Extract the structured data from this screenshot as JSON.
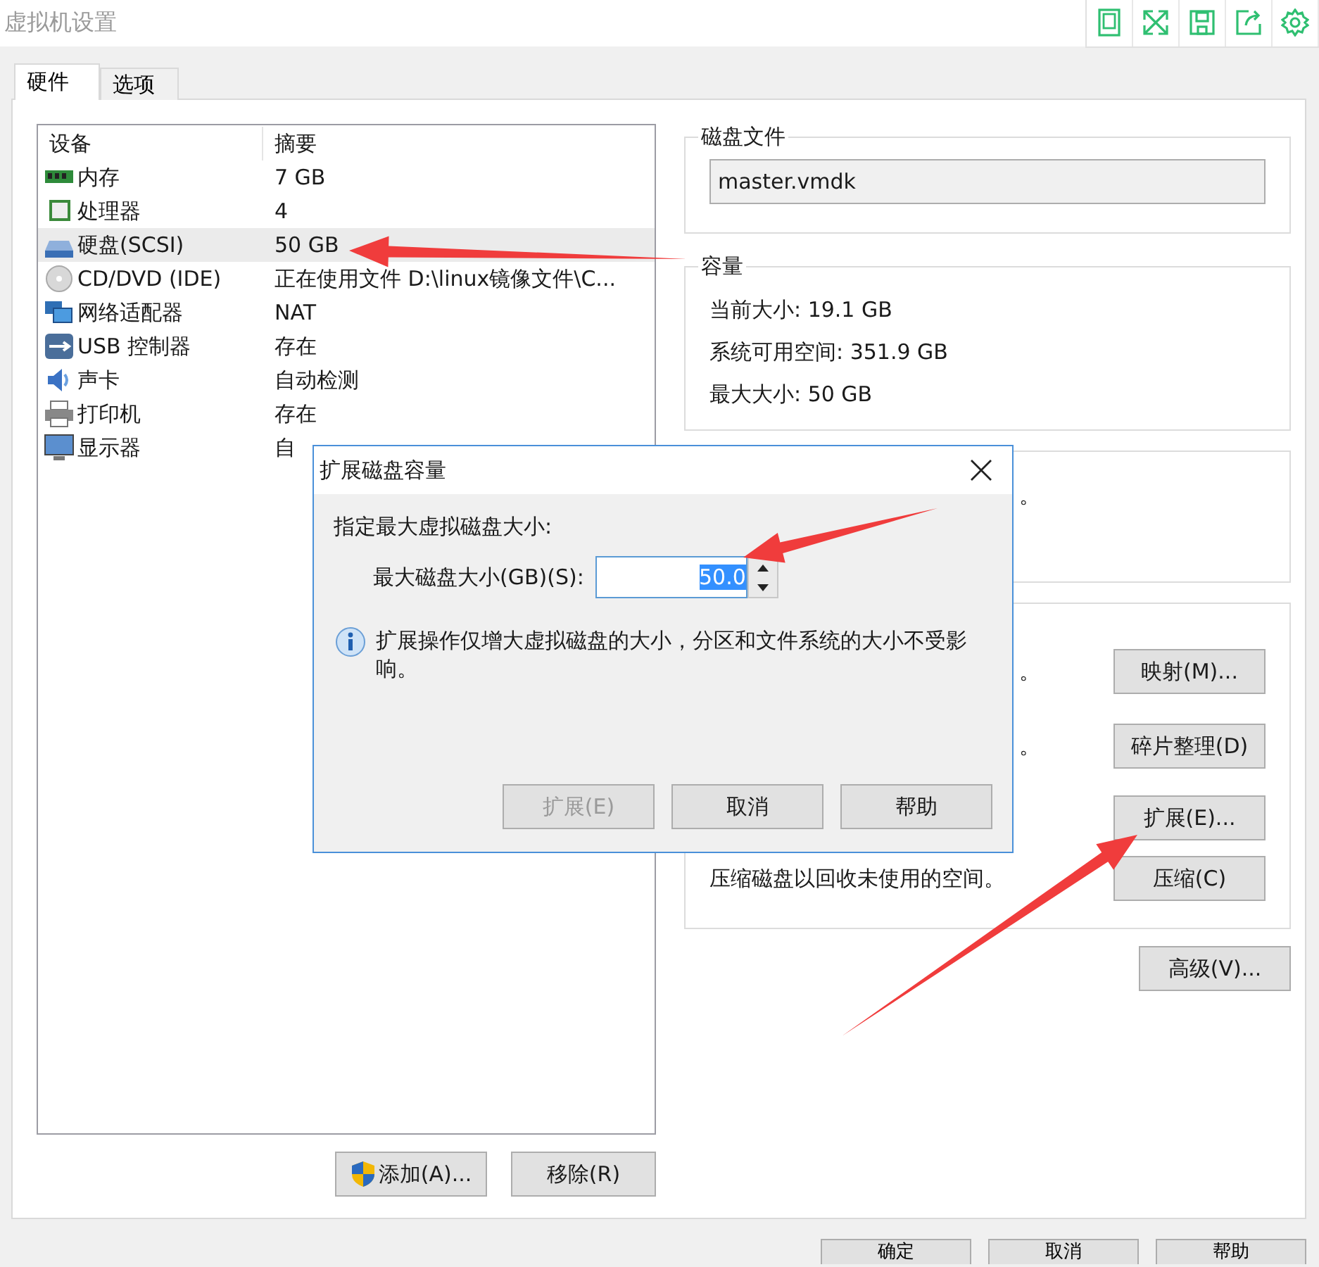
{
  "window": {
    "title": "虚拟机设置"
  },
  "tabs": [
    {
      "label": "硬件",
      "selected": true
    },
    {
      "label": "选项",
      "selected": false
    }
  ],
  "device_list": {
    "columns": [
      "设备",
      "摘要"
    ],
    "rows": [
      {
        "kind": "memory",
        "device": "内存",
        "summary": "7 GB",
        "selected": false
      },
      {
        "kind": "cpu",
        "device": "处理器",
        "summary": "4",
        "selected": false
      },
      {
        "kind": "disk",
        "device": "硬盘(SCSI)",
        "summary": "50 GB",
        "selected": true
      },
      {
        "kind": "cd",
        "device": "CD/DVD (IDE)",
        "summary": "正在使用文件 D:\\linux镜像文件\\C...",
        "selected": false
      },
      {
        "kind": "network",
        "device": "网络适配器",
        "summary": "NAT",
        "selected": false
      },
      {
        "kind": "usb",
        "device": "USB 控制器",
        "summary": "存在",
        "selected": false
      },
      {
        "kind": "sound",
        "device": "声卡",
        "summary": "自动检测",
        "selected": false
      },
      {
        "kind": "printer",
        "device": "打印机",
        "summary": "存在",
        "selected": false
      },
      {
        "kind": "display",
        "device": "显示器",
        "summary": "自",
        "selected": false
      }
    ]
  },
  "list_buttons": [
    {
      "label": "添加(A)...",
      "kind": "shield"
    },
    {
      "label": "移除(R)",
      "kind": "plain"
    }
  ],
  "disk_file": {
    "legend": "磁盘文件",
    "value": "master.vmdk"
  },
  "capacity": {
    "legend": "容量",
    "lines": [
      "当前大小: 19.1 GB",
      "系统可用空间: 351.9 GB",
      "最大大小: 50 GB"
    ]
  },
  "mapping_group": {
    "fragment": "。"
  },
  "utilities": [
    {
      "kind": "fragment",
      "text": "。",
      "button": "映射(M)..."
    },
    {
      "kind": "fragment",
      "text": "。",
      "button": "碎片整理(D)"
    },
    {
      "kind": "hidden",
      "button": "扩展(E)..."
    },
    {
      "kind": "text",
      "text": "压缩磁盘以回收未使用的空间。",
      "button": "压缩(C)"
    }
  ],
  "advanced_button": "高级(V)...",
  "footer_buttons": [
    "确定",
    "取消",
    "帮助"
  ],
  "dialog": {
    "title": "扩展磁盘容量",
    "prompt": "指定最大虚拟磁盘大小:",
    "field_label": "最大磁盘大小(GB)(S):",
    "value": "50.0",
    "info": "扩展操作仅增大虚拟磁盘的大小，分区和文件系统的大小不受影响。",
    "buttons": [
      {
        "label": "扩展(E)",
        "disabled": true
      },
      {
        "label": "取消",
        "disabled": false
      },
      {
        "label": "帮助",
        "disabled": false
      }
    ]
  }
}
